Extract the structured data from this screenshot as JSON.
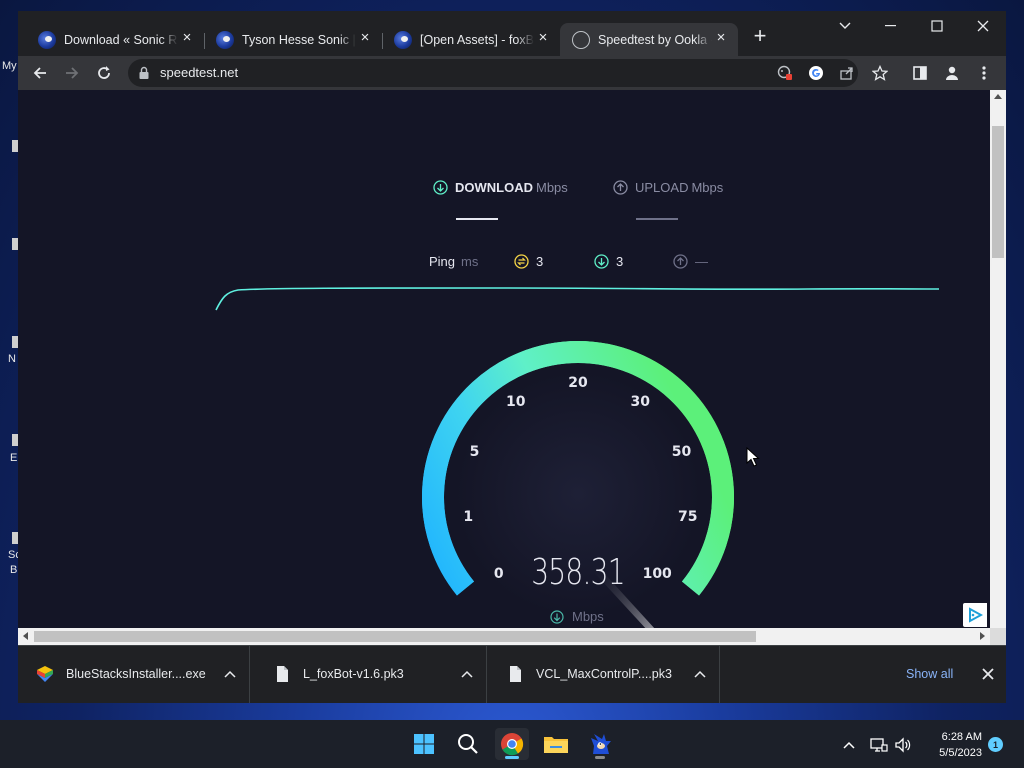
{
  "desktop": {
    "labels": [
      "My",
      "N",
      "E",
      "Sc",
      "B"
    ]
  },
  "browser": {
    "tabs": [
      {
        "title": "Download « Sonic Ro",
        "icon": "sonic-favicon"
      },
      {
        "title": "Tyson Hesse Sonic | S",
        "icon": "sonic-favicon"
      },
      {
        "title": "[Open Assets] - foxBo",
        "icon": "sonic-favicon"
      },
      {
        "title": "Speedtest by Ookla -",
        "icon": "speedtest-favicon",
        "active": true
      }
    ],
    "url": "speedtest.net"
  },
  "speedtest": {
    "download_label": "DOWNLOAD",
    "download_unit": "Mbps",
    "upload_label": "UPLOAD",
    "upload_unit": "Mbps",
    "ping_label": "Ping",
    "ping_unit": "ms",
    "ping_idle": "3",
    "ping_download": "3",
    "ping_upload": "—",
    "gauge_ticks": [
      "0",
      "1",
      "5",
      "10",
      "20",
      "30",
      "50",
      "75",
      "100"
    ],
    "speed_value": "358.31",
    "speed_unit": "Mbps",
    "colors": {
      "accent": "#5ff0c8",
      "gauge_start": "#1fb3ff",
      "gauge_end": "#5cf07a",
      "background": "#141526"
    }
  },
  "downloads": {
    "items": [
      {
        "name": "BlueStacksInstaller....exe",
        "icon": "bluestacks-icon"
      },
      {
        "name": "L_foxBot-v1.6.pk3",
        "icon": "file-icon"
      },
      {
        "name": "VCL_MaxControlP....pk3",
        "icon": "file-icon"
      }
    ],
    "show_all": "Show all"
  },
  "taskbar": {
    "time": "6:28 AM",
    "date": "5/5/2023",
    "notification_count": "1"
  }
}
